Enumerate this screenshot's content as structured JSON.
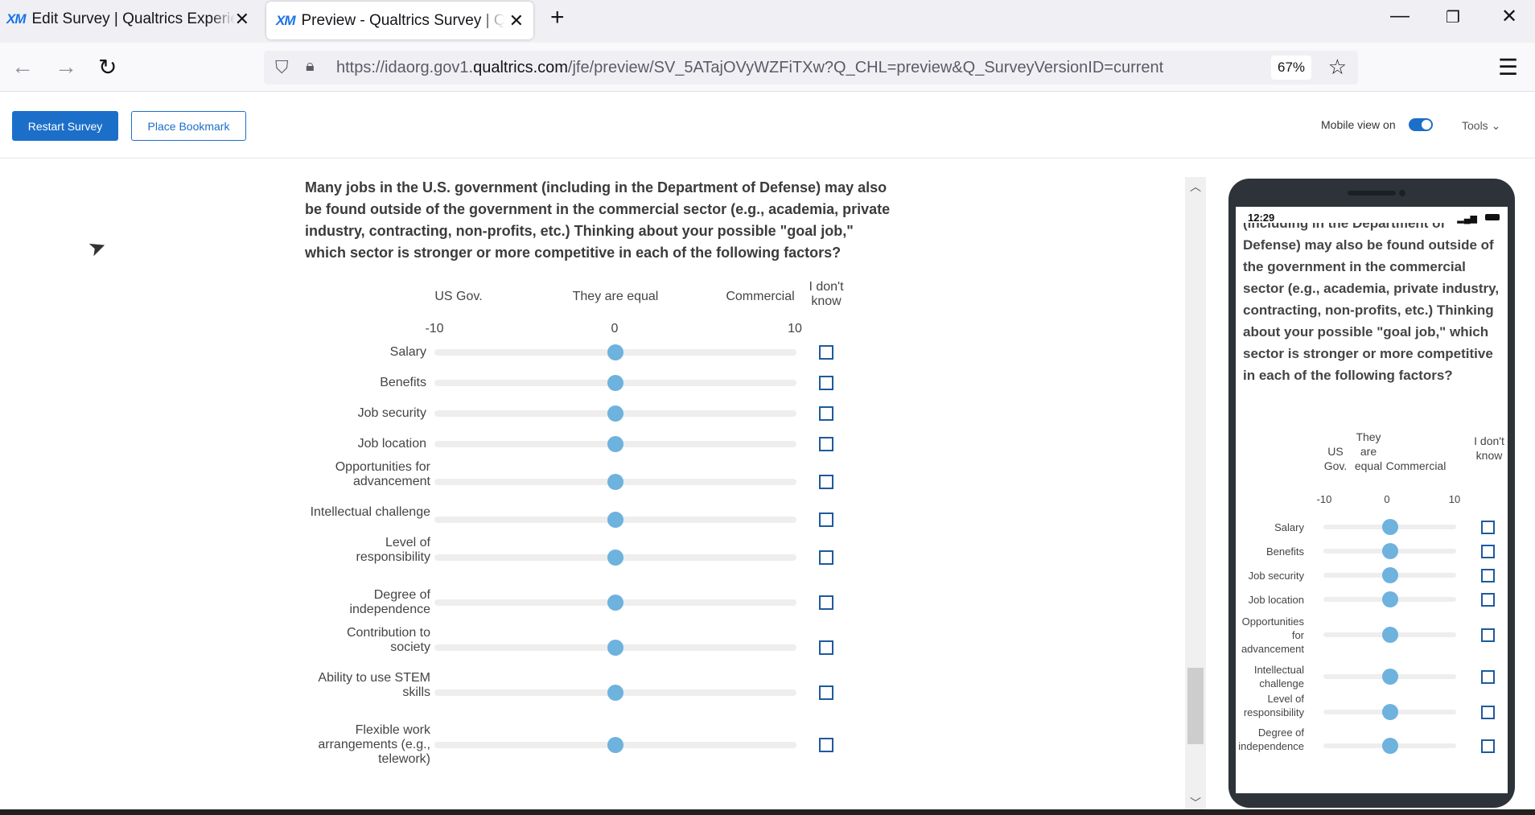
{
  "browser": {
    "tabs": [
      {
        "icon": "XM",
        "title": "Edit Survey | Qualtrics Experienc"
      },
      {
        "icon": "XM",
        "title": "Preview - Qualtrics Survey | Qua"
      }
    ],
    "url_prefix": "https://idaorg.gov1.",
    "url_domain": "qualtrics.com",
    "url_path": "/jfe/preview/SV_5ATajOVyWZFiTXw?Q_CHL=preview&Q_SurveyVersionID=current",
    "zoom": "67%"
  },
  "toolbar": {
    "restart": "Restart Survey",
    "bookmark": "Place Bookmark",
    "mobile_label": "Mobile view on",
    "mobile_on": true,
    "tools": "Tools ⌄"
  },
  "question": "Many jobs in the U.S. government (including in the Department of Defense) may also be found outside of the government in the commercial sector (e.g., academia, private industry, contracting, non-profits, etc.)  Thinking about your possible \"goal job,\" which sector is stronger or more competitive in each of the following factors?",
  "scale": {
    "left": "US Gov.",
    "mid": "They are equal",
    "right": "Commercial",
    "dk": "I don't know",
    "min": "-10",
    "zero": "0",
    "max": "10"
  },
  "rows": [
    "Salary",
    "Benefits",
    "Job security",
    "Job location",
    "Opportunities for advancement",
    "Intellectual challenge",
    "Level of responsibility",
    "Degree of independence",
    "Contribution to society",
    "Ability to use STEM skills",
    "Flexible work arrangements (e.g., telework)"
  ],
  "slider_value": 0,
  "phone": {
    "time": "12:29",
    "question": "Many jobs in the U.S. government (including in the Department of Defense) may also be found outside of the government in the commercial sector (e.g., academia, private industry, contracting, non-profits, etc.)  Thinking about your possible \"goal job,\" which sector is stronger or more competitive in each of the following factors?",
    "left": "US Gov.",
    "mid": "They are equal",
    "right": "Commercial",
    "dk": "I don't know",
    "rows": [
      "Salary",
      "Benefits",
      "Job security",
      "Job location",
      "Opportunities for advancement",
      "Intellectual challenge",
      "Level of responsibility",
      "Degree of independence"
    ]
  },
  "colors": {
    "accent": "#1c6fc9",
    "slider": "#6eb2de",
    "checkbox": "#1f5a9c"
  }
}
